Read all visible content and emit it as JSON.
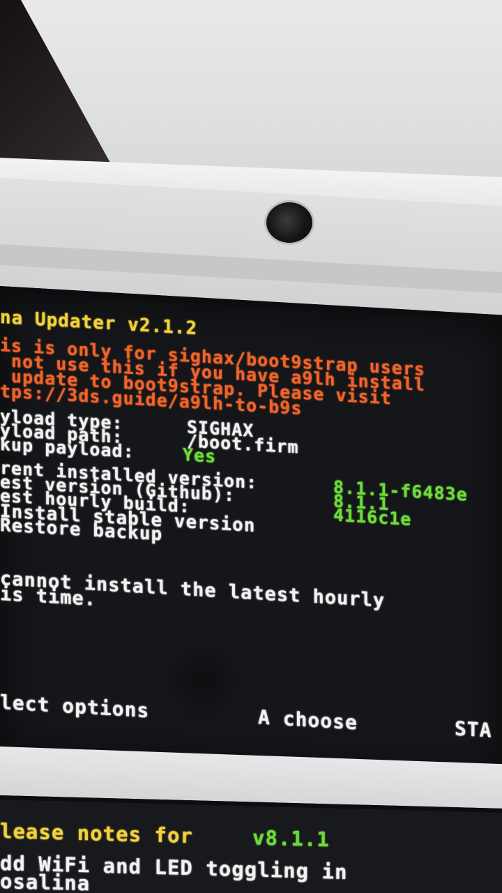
{
  "top_screen": {
    "title": "na Updater v2.1.2",
    "warning_lines": [
      "is is only for sighax/boot9strap users",
      " not use this if you have a9lh install",
      " update to boot9strap. Please visit",
      "tps://3ds.guide/a9lh-to-b9s"
    ],
    "payload": {
      "type_label": "yload type:",
      "type_value": "SIGHAX",
      "path_label": "yload path:",
      "path_value": "/boot.firm",
      "backup_label": "kup payload:",
      "backup_value": "Yes"
    },
    "version_info": {
      "current_label": "rent installed version:",
      "current_value": "8.1.1-f6483e",
      "github_label": "est version (Github):",
      "github_value": "8.1.1",
      "hourly_label": "est hourly build:",
      "hourly_value": "4116c1e"
    },
    "menu": {
      "install_stable": "Install stable version",
      "restore_backup": "Restore backup"
    },
    "notice_line1": "cannot install the latest hourly",
    "notice_line2": "is time.",
    "footer": {
      "select_hint": "lect options",
      "choose_hint": "A choose",
      "start_hint": "STA"
    }
  },
  "bottom_screen": {
    "release_prefix": "lease notes for",
    "release_version": "v8.1.1",
    "note_line1": "dd WiFi and LED toggling in",
    "note_line2": "osalina"
  },
  "colors": {
    "title": "#f2d23c",
    "warning": "#f0642a",
    "text": "#f2f2f2",
    "value": "#6fdb3a"
  }
}
